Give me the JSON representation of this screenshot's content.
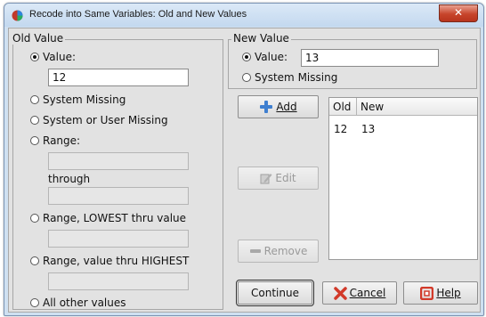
{
  "window": {
    "title": "Recode into Same Variables: Old and New Values",
    "close_label": "✕"
  },
  "old_value": {
    "legend": "Old Value",
    "value_label": "Value:",
    "value": "12",
    "system_missing": "System Missing",
    "system_or_user_missing": "System or User Missing",
    "range": "Range:",
    "range_from": "",
    "through": "through",
    "range_to": "",
    "range_lowest": "Range, LOWEST thru value",
    "range_lowest_value": "",
    "range_highest": "Range, value thru HIGHEST",
    "range_highest_value": "",
    "all_other": "All other values",
    "selected": "value"
  },
  "new_value": {
    "legend": "New Value",
    "value_label": "Value:",
    "value": "13",
    "system_missing": "System Missing",
    "selected": "value"
  },
  "buttons": {
    "add": "Add",
    "edit": "Edit",
    "remove": "Remove",
    "continue": "Continue",
    "cancel": "Cancel",
    "help": "Help"
  },
  "mapping_list": {
    "headers": [
      "Old",
      "New"
    ],
    "rows": [
      {
        "old": "12",
        "new": "13"
      }
    ]
  },
  "colors": {
    "add_icon": "#3f7fd0",
    "cancel_icon": "#d23a2a",
    "help_icon": "#d23a2a"
  },
  "icons": {
    "app": "spss-app-icon",
    "add": "plus-icon",
    "edit": "pencil-icon",
    "remove": "minus-icon",
    "cancel": "x-icon",
    "help": "lifebuoy-icon"
  }
}
